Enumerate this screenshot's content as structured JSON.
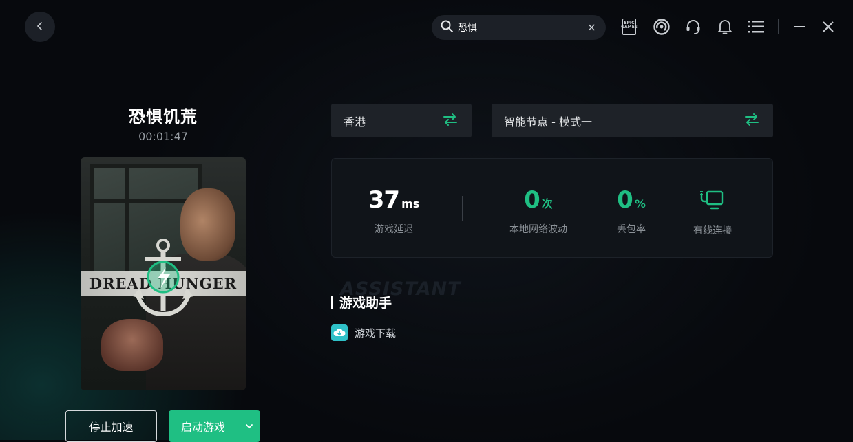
{
  "search": {
    "value": "恐惧",
    "clear": "×"
  },
  "header": {
    "epic_label": "EPIC GAMES"
  },
  "game": {
    "title": "恐惧饥荒",
    "elapsed": "00:01:47",
    "cover_logo_text": "DREAD HUNGER"
  },
  "actions": {
    "stop_label": "停止加速",
    "start_label": "启动游戏"
  },
  "region": {
    "selected": "香港"
  },
  "node": {
    "selected": "智能节点 - 模式一"
  },
  "stats": {
    "latency": {
      "value": "37",
      "unit": "ms",
      "label": "游戏延迟"
    },
    "jitter": {
      "value": "0",
      "unit": "次",
      "label": "本地网络波动"
    },
    "packet_loss": {
      "value": "0",
      "unit": "%",
      "label": "丢包率"
    },
    "connection": {
      "label": "有线连接"
    }
  },
  "assistant": {
    "watermark": "ASSISTANT",
    "title": "游戏助手",
    "items": [
      {
        "label": "游戏下载",
        "icon": "cloud-download-icon"
      }
    ]
  },
  "colors": {
    "accent": "#1fbf83",
    "download_icon": "#2fc1c8",
    "background": "#07090d"
  }
}
